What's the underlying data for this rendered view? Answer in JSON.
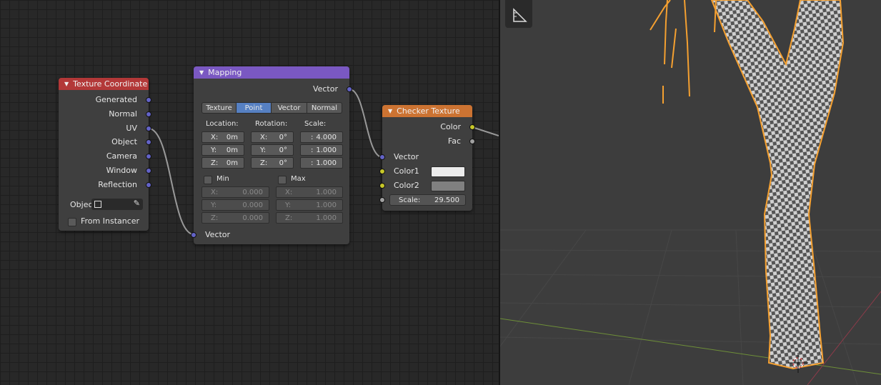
{
  "texture_coordinate": {
    "title": "Texture Coordinate",
    "outputs": [
      "Generated",
      "Normal",
      "UV",
      "Object",
      "Camera",
      "Window",
      "Reflection"
    ],
    "object_label": "Objec",
    "from_instancer": "From Instancer"
  },
  "mapping": {
    "title": "Mapping",
    "output": "Vector",
    "tabs": [
      "Texture",
      "Point",
      "Vector",
      "Normal"
    ],
    "active_tab": "Point",
    "location_label": "Location:",
    "rotation_label": "Rotation:",
    "scale_label": "Scale:",
    "location": [
      {
        "axis": "X:",
        "value": "0m"
      },
      {
        "axis": "Y:",
        "value": "0m"
      },
      {
        "axis": "Z:",
        "value": "0m"
      }
    ],
    "rotation": [
      {
        "axis": "X:",
        "value": "0°"
      },
      {
        "axis": "Y:",
        "value": "0°"
      },
      {
        "axis": "Z:",
        "value": "0°"
      }
    ],
    "scale": [
      {
        "axis": ":",
        "value": "4.000"
      },
      {
        "axis": ":",
        "value": "1.000"
      },
      {
        "axis": ":",
        "value": "1.000"
      }
    ],
    "min_label": "Min",
    "max_label": "Max",
    "min": [
      {
        "axis": "X:",
        "value": "0.000"
      },
      {
        "axis": "Y:",
        "value": "0.000"
      },
      {
        "axis": "Z:",
        "value": "0.000"
      }
    ],
    "max": [
      {
        "axis": "X:",
        "value": "1.000"
      },
      {
        "axis": "Y:",
        "value": "1.000"
      },
      {
        "axis": "Z:",
        "value": "1.000"
      }
    ],
    "input": "Vector"
  },
  "checker": {
    "title": "Checker Texture",
    "outputs": [
      "Color",
      "Fac"
    ],
    "vector": "Vector",
    "color1": "Color1",
    "color2": "Color2",
    "color1_value": "#ececec",
    "color2_value": "#808080",
    "scale_label": "Scale:",
    "scale_value": "29.500"
  },
  "colors": {
    "tex_coord_header": "#b33838",
    "mapping_header": "#7a58c2",
    "checker_header": "#cc7332",
    "selection_outline": "#f5a030"
  }
}
